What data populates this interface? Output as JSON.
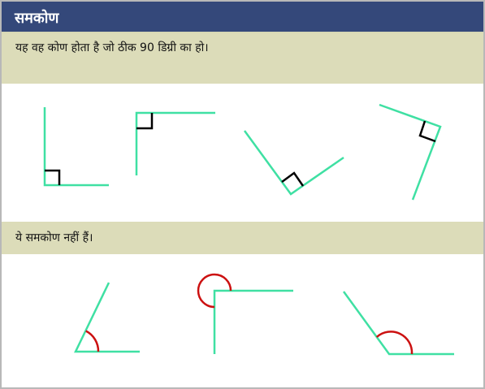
{
  "title": "समकोण",
  "definition": "यह वह कोण होता है जो ठीक 90 डिग्री का हो।",
  "non_examples_caption": "ये समकोण नहीं हैं।",
  "colors": {
    "header_bg": "#34487a",
    "band_bg": "#dcdcb9",
    "ray": "#3fe0a3",
    "right_angle_marker": "#000000",
    "arc_marker": "#cc1111"
  }
}
